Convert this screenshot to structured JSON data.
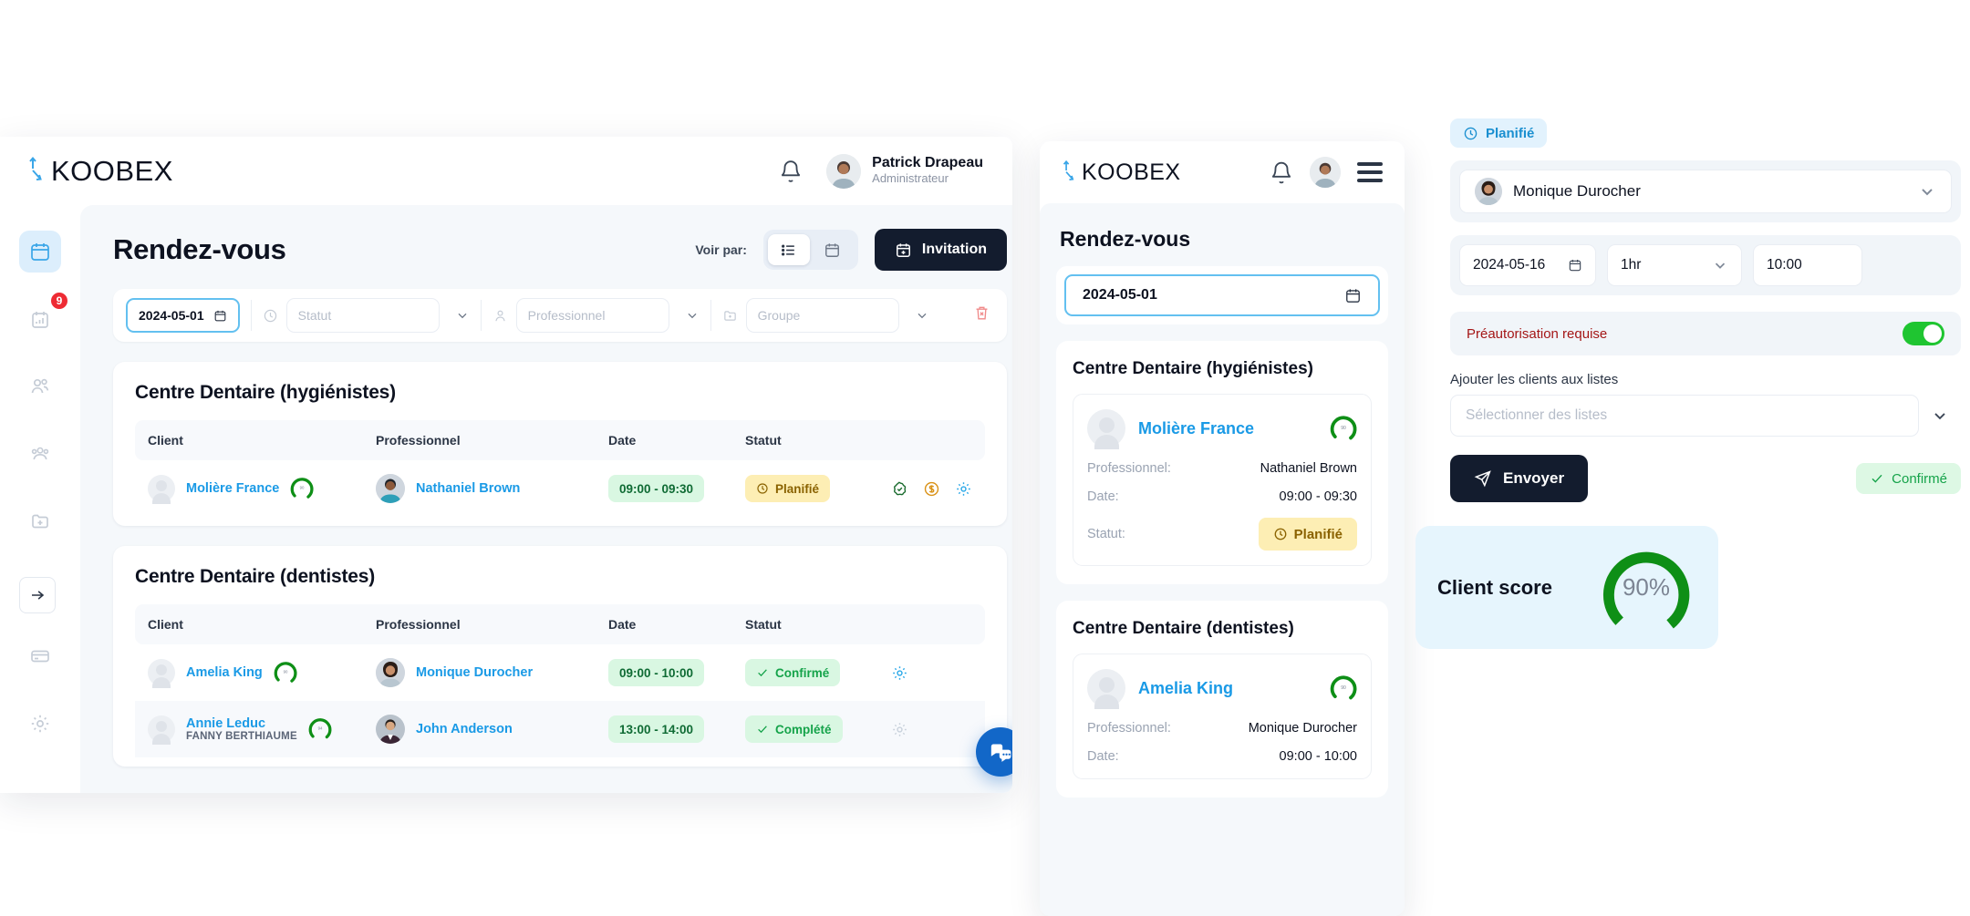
{
  "brand": {
    "name": "KOOBEX",
    "accent": "#3aa6e8"
  },
  "desktop": {
    "header": {
      "user_name": "Patrick Drapeau",
      "user_role": "Administrateur",
      "bell_icon": "bell-icon"
    },
    "sidebar": {
      "items": [
        {
          "icon": "calendar-icon",
          "name": "appointments",
          "active": true,
          "badge": ""
        },
        {
          "icon": "chart-calendar-icon",
          "name": "reports",
          "active": false,
          "badge": "9"
        },
        {
          "icon": "users-icon",
          "name": "clients",
          "active": false,
          "badge": ""
        },
        {
          "icon": "group-icon",
          "name": "groups",
          "active": false,
          "badge": ""
        },
        {
          "icon": "folder-plus-icon",
          "name": "files",
          "active": false,
          "badge": ""
        },
        {
          "icon": "clipboard-icon",
          "name": "forms",
          "active": false,
          "badge": ""
        },
        {
          "icon": "card-icon",
          "name": "billing",
          "active": false,
          "badge": ""
        },
        {
          "icon": "gear-icon",
          "name": "settings",
          "active": false,
          "badge": ""
        }
      ],
      "expand_icon": "arrow-right-icon"
    },
    "page_title": "Rendez-vous",
    "view_controls": {
      "label": "Voir par:",
      "options": [
        {
          "icon": "list-icon",
          "name": "list-view",
          "selected": true
        },
        {
          "icon": "calendar-icon",
          "name": "calendar-view",
          "selected": false
        }
      ],
      "invitation_button": {
        "label": "Invitation",
        "icon": "calendar-plus-icon"
      }
    },
    "filters": {
      "date_value": "2024-05-01",
      "date_icon": "calendar-icon",
      "statut_placeholder": "Statut",
      "statut_icon": "clock-icon",
      "professionnel_placeholder": "Professionnel",
      "professionnel_icon": "user-icon",
      "groupe_placeholder": "Groupe",
      "groupe_icon": "folder-plus-icon",
      "clear_icon": "trash-icon"
    },
    "columns": [
      "Client",
      "Professionnel",
      "Date",
      "Statut"
    ],
    "sections": [
      {
        "title": "Centre Dentaire (hygiénistes)",
        "rows": [
          {
            "client": "Molière France",
            "client_sub": "",
            "score": "90",
            "professional": "Nathaniel Brown",
            "time": "09:00 - 09:30",
            "status": "Planifié",
            "status_type": "planned",
            "actions": [
              "verified-check-icon",
              "dollar-icon",
              "gear-icon"
            ]
          }
        ]
      },
      {
        "title": "Centre Dentaire (dentistes)",
        "rows": [
          {
            "client": "Amelia King",
            "client_sub": "",
            "score": "90",
            "professional": "Monique Durocher",
            "time": "09:00 - 10:00",
            "status": "Confirmé",
            "status_type": "confirmed",
            "actions": [
              "gear-icon"
            ]
          },
          {
            "client": "Annie Leduc",
            "client_sub": "FANNY BERTHIAUME",
            "score": "94",
            "professional": "John Anderson",
            "time": "13:00 - 14:00",
            "status": "Complété",
            "status_type": "completed",
            "actions": [
              "gear-icon"
            ]
          }
        ]
      }
    ],
    "chat_fab_icon": "chat-bubbles-icon"
  },
  "mobile": {
    "header": {
      "bell_icon": "bell-icon",
      "menu_icon": "hamburger-icon"
    },
    "page_title": "Rendez-vous",
    "date_value": "2024-05-01",
    "date_icon": "calendar-icon",
    "labels": {
      "professionnel": "Professionnel:",
      "date": "Date:",
      "statut": "Statut:"
    },
    "cards": [
      {
        "title": "Centre Dentaire (hygiénistes)",
        "client": "Molière France",
        "score": "90",
        "professional": "Nathaniel Brown",
        "time": "09:00 - 09:30",
        "status": "Planifié"
      },
      {
        "title": "Centre Dentaire (dentistes)",
        "client": "Amelia King",
        "score": "90",
        "professional": "Monique Durocher",
        "time": "09:00 - 10:00",
        "status": ""
      }
    ]
  },
  "panel": {
    "status_pill": {
      "label": "Planifié",
      "icon": "clock-icon",
      "color": "#1a8fd0"
    },
    "professional_select": {
      "value": "Monique Durocher",
      "chevron": "chevron-down-icon"
    },
    "date_value": "2024-05-16",
    "date_icon": "calendar-icon",
    "duration_value": "1hr",
    "duration_chevron": "chevron-down-icon",
    "time_value": "10:00",
    "preauth": {
      "label": "Préautorisation requise",
      "enabled": true,
      "color": "#a41616",
      "toggle_color": "#1fc531"
    },
    "lists": {
      "label": "Ajouter les clients aux listes",
      "placeholder": "Sélectionner des listes",
      "chevron": "chevron-down-icon"
    },
    "send_button": {
      "label": "Envoyer",
      "icon": "send-icon"
    },
    "confirmed_pill": {
      "label": "Confirmé",
      "icon": "check-icon",
      "color": "#15a34a"
    },
    "score_card": {
      "label": "Client score",
      "value": "90%",
      "percent": 90,
      "ring_color": "#0e8f16",
      "track_color": "#e3e7ec",
      "bg": "#e6f5fd"
    }
  }
}
